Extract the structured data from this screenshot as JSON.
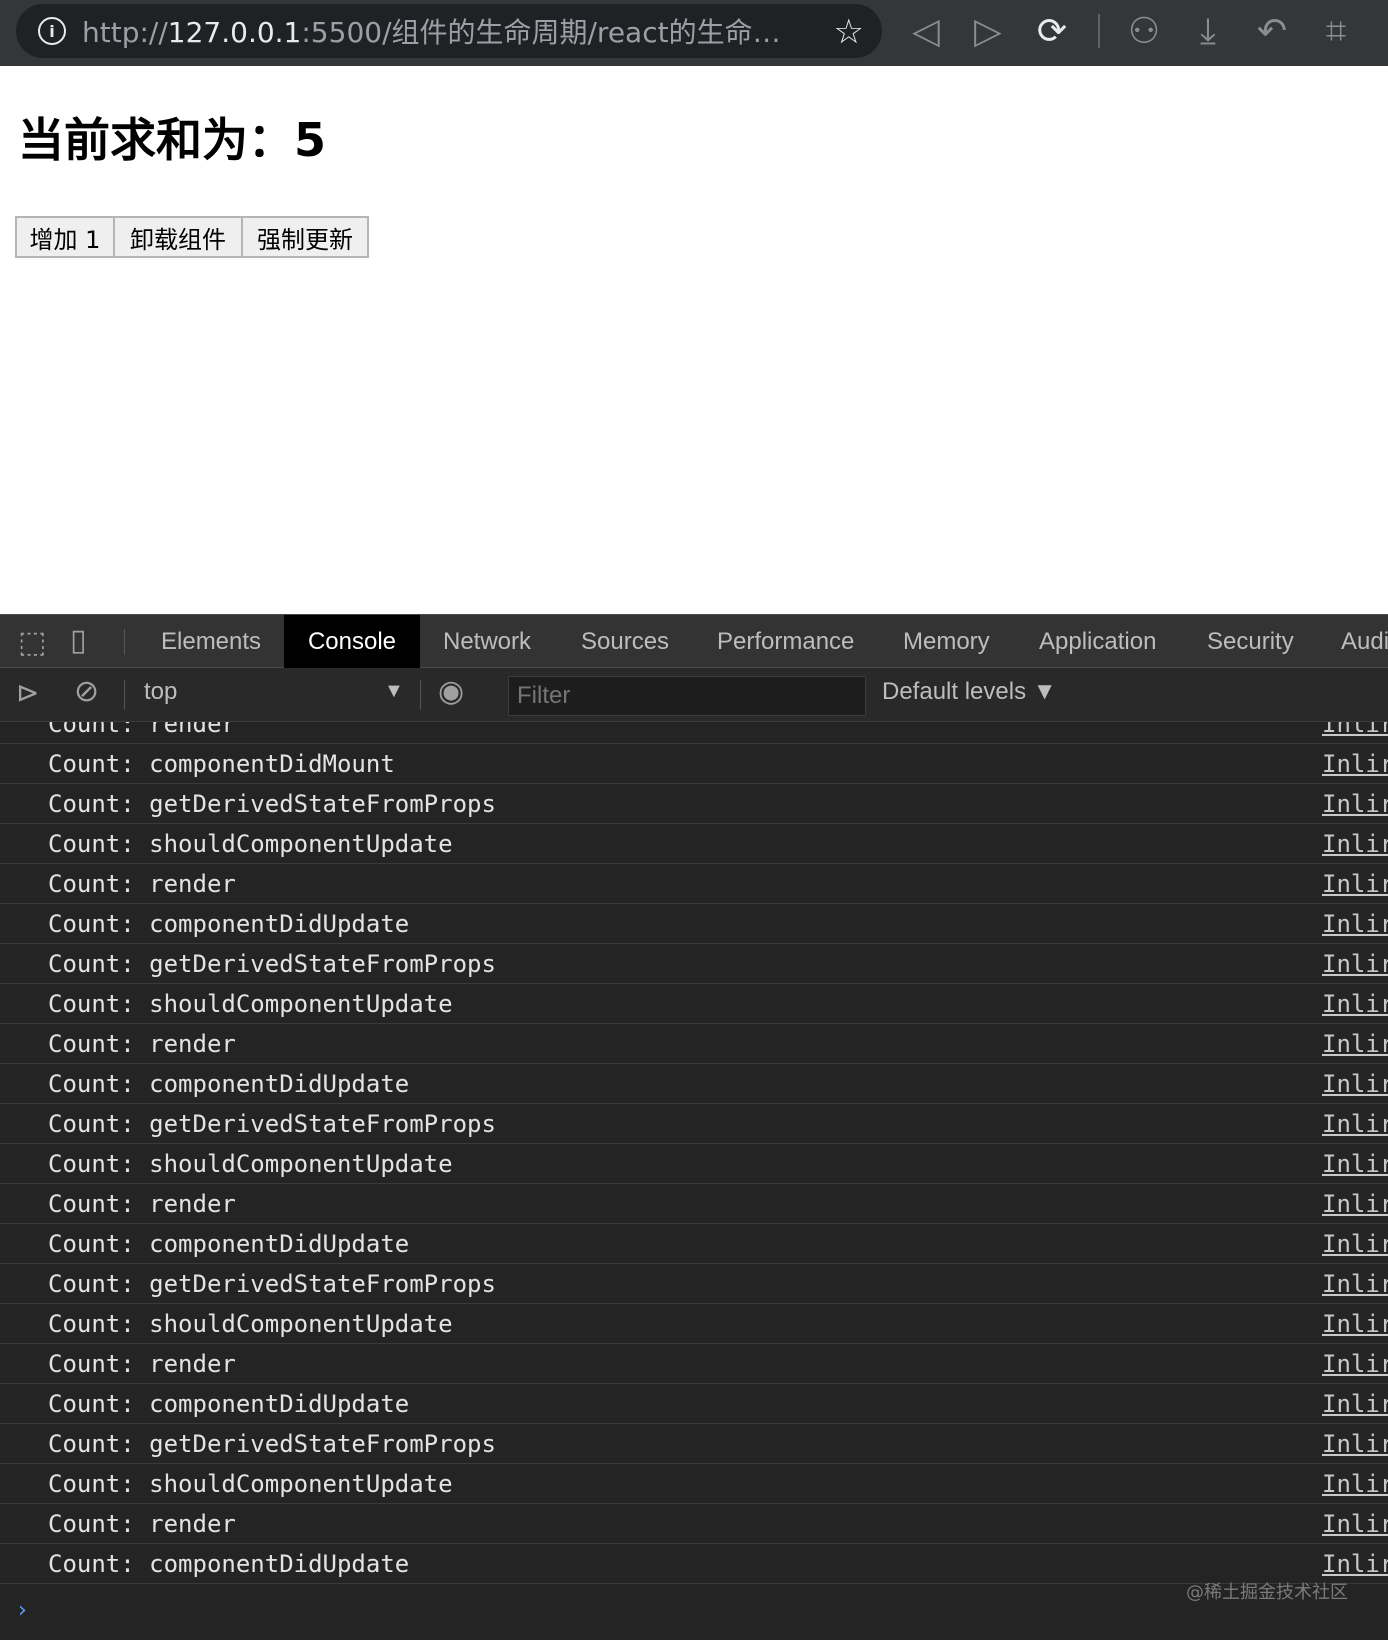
{
  "browser": {
    "url_prefix": "http://",
    "url_host": "127.0.0.1",
    "url_rest": ":5500/组件的生命周期/react的生命周期..."
  },
  "page": {
    "heading": "当前求和为：5",
    "buttons": [
      "增加 1",
      "卸载组件",
      "强制更新"
    ]
  },
  "devtools": {
    "tabs": [
      "Elements",
      "Console",
      "Network",
      "Sources",
      "Performance",
      "Memory",
      "Application",
      "Security",
      "Audi"
    ],
    "active_tab": "Console",
    "context": "top",
    "filter_placeholder": "Filter",
    "levels": "Default levels ▼",
    "logs": [
      {
        "text": "Count: render",
        "source": "Inlir"
      },
      {
        "text": "Count: componentDidMount",
        "source": "Inlir"
      },
      {
        "text": "Count: getDerivedStateFromProps",
        "source": "Inlir"
      },
      {
        "text": "Count: shouldComponentUpdate",
        "source": "Inlir"
      },
      {
        "text": "Count: render",
        "source": "Inlir"
      },
      {
        "text": "Count: componentDidUpdate",
        "source": "Inlir"
      },
      {
        "text": "Count: getDerivedStateFromProps",
        "source": "Inlir"
      },
      {
        "text": "Count: shouldComponentUpdate",
        "source": "Inlir"
      },
      {
        "text": "Count: render",
        "source": "Inlir"
      },
      {
        "text": "Count: componentDidUpdate",
        "source": "Inlir"
      },
      {
        "text": "Count: getDerivedStateFromProps",
        "source": "Inlir"
      },
      {
        "text": "Count: shouldComponentUpdate",
        "source": "Inlir"
      },
      {
        "text": "Count: render",
        "source": "Inlir"
      },
      {
        "text": "Count: componentDidUpdate",
        "source": "Inlir"
      },
      {
        "text": "Count: getDerivedStateFromProps",
        "source": "Inlir"
      },
      {
        "text": "Count: shouldComponentUpdate",
        "source": "Inlir"
      },
      {
        "text": "Count: render",
        "source": "Inlir"
      },
      {
        "text": "Count: componentDidUpdate",
        "source": "Inlir"
      },
      {
        "text": "Count: getDerivedStateFromProps",
        "source": "Inlir"
      },
      {
        "text": "Count: shouldComponentUpdate",
        "source": "Inlir"
      },
      {
        "text": "Count: render",
        "source": "Inlir"
      },
      {
        "text": "Count: componentDidUpdate",
        "source": "Inlir"
      }
    ],
    "prompt": "›"
  },
  "watermark": "@稀土掘金技术社区"
}
